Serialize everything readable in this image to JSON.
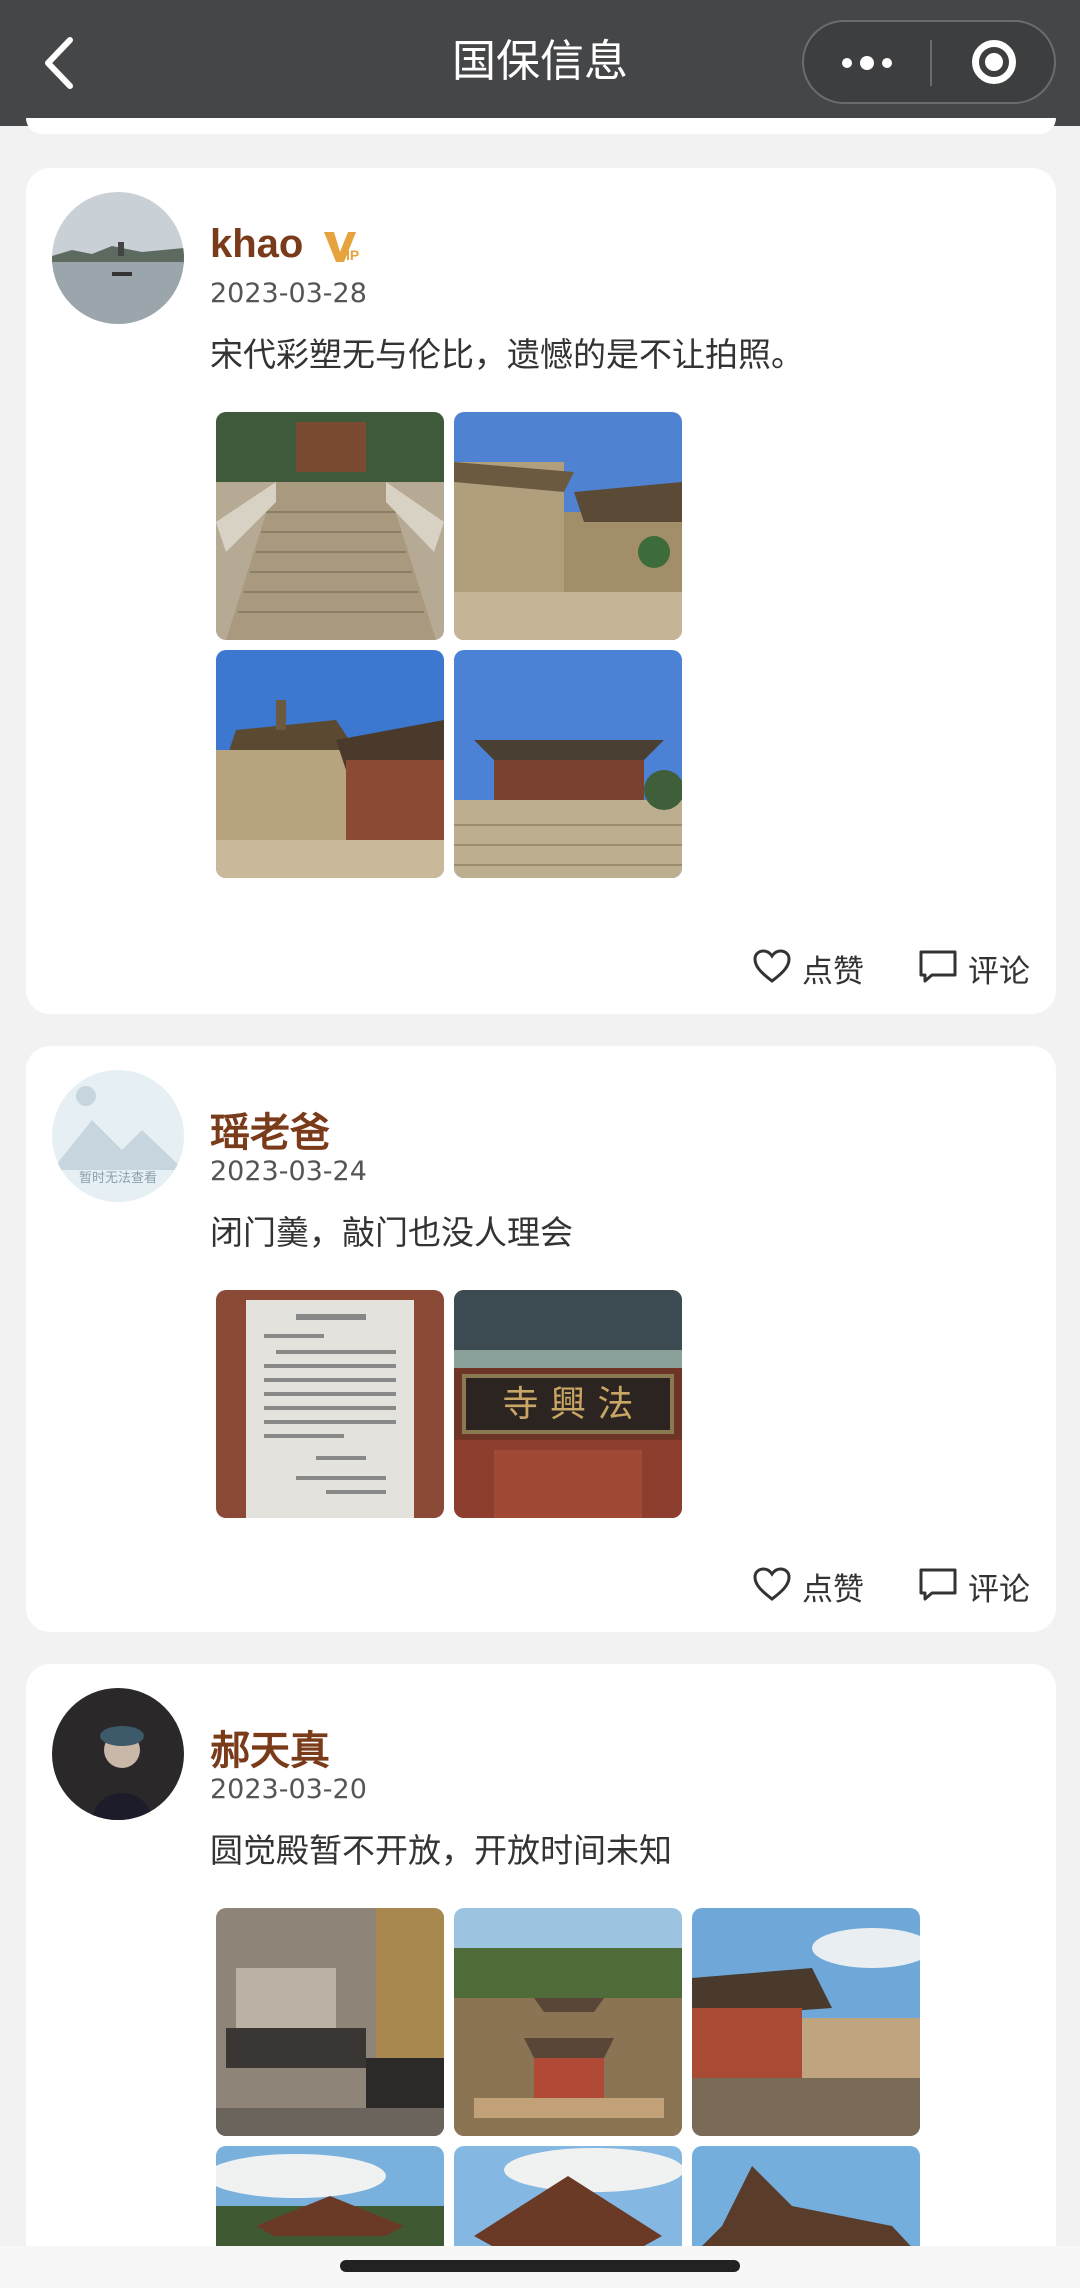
{
  "nav": {
    "title": "国保信息",
    "back_icon": "chevron-left-icon",
    "menu_icon": "more-dots-icon",
    "close_icon": "target-circle-icon",
    "background": "#444648"
  },
  "posts": [
    {
      "username": "khao",
      "vip": true,
      "date": "2023-03-28",
      "content": "宋代彩塑无与伦比，遗憾的是不让拍照。",
      "photos": [
        "temple-stone-stairway",
        "temple-tower-side",
        "temple-pagoda-courtyard",
        "temple-main-hall"
      ],
      "like_label": "点赞",
      "comment_label": "评论"
    },
    {
      "username": "瑶老爸",
      "vip": false,
      "date": "2023-03-24",
      "avatar_text": "暂时无法查看",
      "content": "闭门羹，敲门也没人理会",
      "photos": [
        "closure-notice-board",
        "temple-name-plaque"
      ],
      "like_label": "点赞",
      "comment_label": "评论"
    },
    {
      "username": "郝天真",
      "vip": false,
      "date": "2023-03-20",
      "content": "圆觉殿暂不开放，开放时间未知",
      "photos": [
        "stone-stele",
        "temple-aerial-view",
        "temple-roofs-view",
        "roof-ridge-1",
        "roof-ridge-2",
        "roof-ridge-3"
      ],
      "like_label": "点赞",
      "comment_label": "评论"
    }
  ],
  "colors": {
    "username": "#7a3b1a",
    "vip_badge": "#e6a23c",
    "page_bg": "#f2f2f2"
  }
}
